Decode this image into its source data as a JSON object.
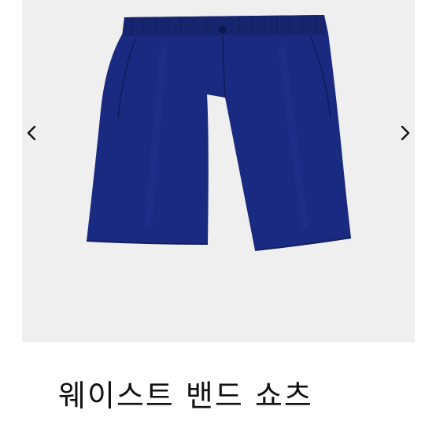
{
  "product": {
    "title": "웨이스트 밴드 쇼츠",
    "description": "",
    "color": "#1a2a80",
    "gallery_background": "#efefef"
  },
  "navigation": {
    "prev_icon": "chevron-left-icon",
    "next_icon": "chevron-right-icon"
  }
}
